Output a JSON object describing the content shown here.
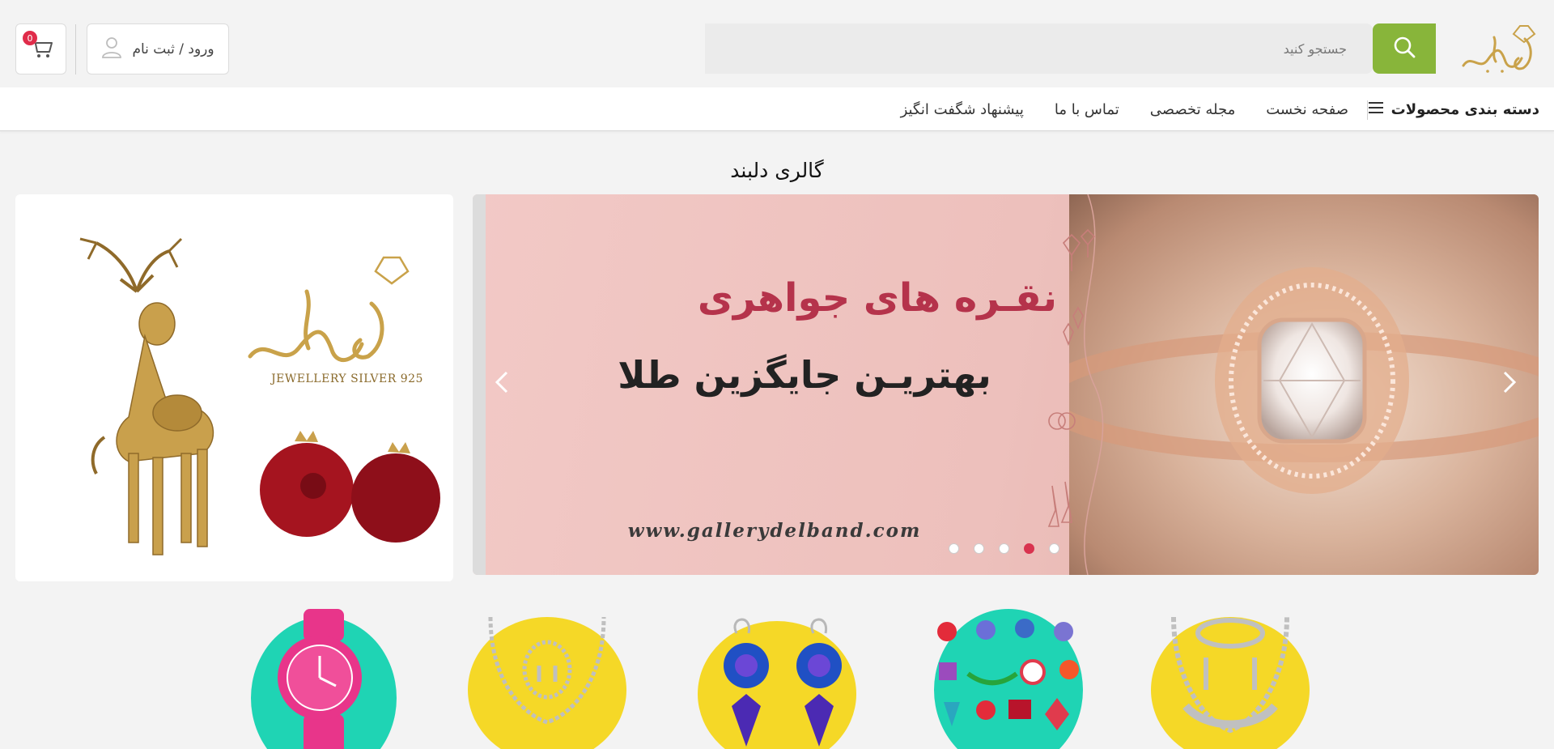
{
  "header": {
    "search_placeholder": "جستجو کنید",
    "login_label": "ورود / ثبت نام",
    "cart_count": "0"
  },
  "nav": {
    "categories_label": "دسته بندی محصولات",
    "links": [
      "صفحه نخست",
      "مجله تخصصی",
      "تماس با ما",
      "پیشنهاد شگفت انگیز"
    ]
  },
  "section": {
    "title": "گالری دلبند"
  },
  "slider": {
    "title": "نقـره های جواهری",
    "subtitle": "بهتریـن جایگزین طلا",
    "url": "www.gallerydelband.com",
    "dots": 5,
    "active_dot": 2
  },
  "side_banner": {
    "brand_text": "JEWELLERY SILVER 925"
  },
  "categories": [
    {
      "icon": "necklace-set-icon"
    },
    {
      "icon": "gemstones-icon"
    },
    {
      "icon": "earrings-icon"
    },
    {
      "icon": "necklace-icon"
    },
    {
      "icon": "watch-icon"
    }
  ],
  "colors": {
    "accent_green": "#88b53a",
    "badge_red": "#e02c4a",
    "gold": "#c9a24a",
    "slider_pink": "#f2c9c6",
    "title_red": "#b5334b"
  }
}
